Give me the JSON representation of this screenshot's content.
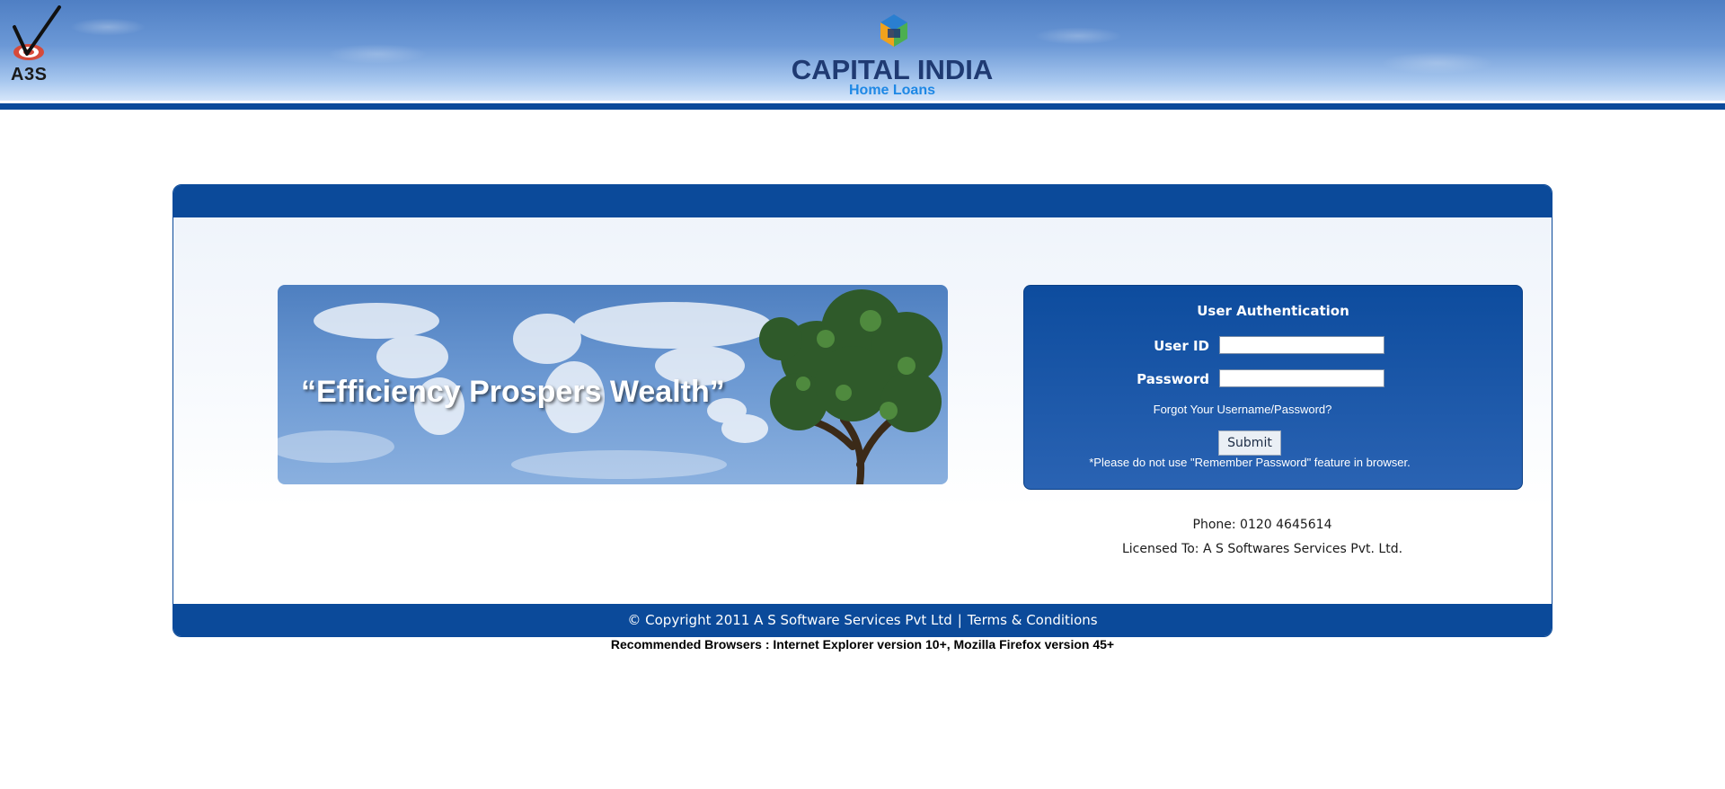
{
  "header": {
    "left_logo_text": "A3S",
    "brand_name": "CAPITAL INDIA",
    "brand_subtitle": "Home Loans"
  },
  "banner": {
    "tagline": "“Efficiency Prospers Wealth”"
  },
  "auth": {
    "title": "User Authentication",
    "user_id_label": "User ID",
    "user_id_value": "",
    "password_label": "Password",
    "password_value": "",
    "forgot_link": "Forgot Your Username/Password?",
    "submit_label": "Submit",
    "note": "*Please do not use \"Remember Password\" feature in browser."
  },
  "contact": {
    "phone": "Phone: 0120 4645614",
    "licensed": "Licensed To: A S Softwares Services Pvt. Ltd."
  },
  "footer": {
    "copyright": "© Copyright 2011 A S Software Services Pvt Ltd",
    "separator": "|",
    "terms_link": "Terms & Conditions",
    "recommended": "Recommended Browsers : Internet Explorer version 10+, Mozilla Firefox version 45+"
  },
  "colors": {
    "primary_blue": "#0b4a9a",
    "header_blue": "#6b98d6",
    "brand_navy": "#1f3a72",
    "brand_sub_blue": "#1e88e5"
  }
}
